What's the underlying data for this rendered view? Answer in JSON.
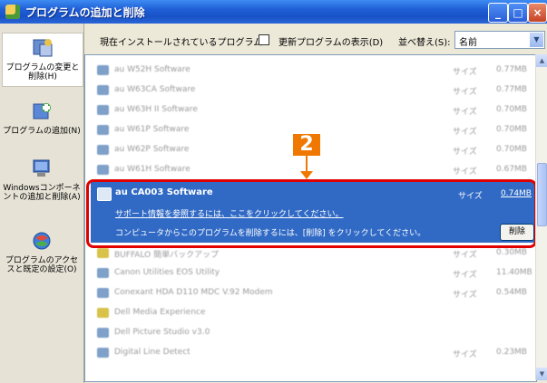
{
  "window": {
    "title": "プログラムの追加と削除",
    "buttons": {
      "minimize": "_",
      "maximize": "□",
      "close": "×"
    }
  },
  "sidebar": {
    "items": [
      {
        "label": "プログラムの変更と削除(H)",
        "icon": "change-remove-programs-icon"
      },
      {
        "label": "プログラムの追加(N)",
        "icon": "add-programs-icon"
      },
      {
        "label": "Windowsコンポーネントの追加と削除(A)",
        "icon": "windows-components-icon"
      },
      {
        "label": "プログラムのアクセスと既定の設定(O)",
        "icon": "program-access-defaults-icon"
      }
    ]
  },
  "toolbar": {
    "installed_label": "現在インストールされているプログラム:",
    "show_updates_label": "更新プログラムの表示(D)",
    "sort_label": "並べ替え(S):",
    "sort_value": "名前"
  },
  "list": {
    "rows_above": [
      {
        "name": "au W52H Software",
        "size_label": "サイズ",
        "size": "0.77MB"
      },
      {
        "name": "au W63CA Software",
        "size_label": "サイズ",
        "size": "0.77MB"
      },
      {
        "name": "au W63H II Software",
        "size_label": "サイズ",
        "size": "0.70MB"
      },
      {
        "name": "au W61P Software",
        "size_label": "サイズ",
        "size": "0.70MB"
      },
      {
        "name": "au W62P Software",
        "size_label": "サイズ",
        "size": "0.70MB"
      },
      {
        "name": "au W61H Software",
        "size_label": "サイズ",
        "size": "0.67MB"
      }
    ],
    "selected": {
      "name": "au CA003 Software",
      "size_label": "サイズ",
      "size": "0.74MB",
      "support_link": "サポート情報を参照するには、ここをクリックしてください。",
      "remove_text": "コンピュータからこのプログラムを削除するには、[削除] をクリックしてください。",
      "remove_button": "削除"
    },
    "rows_below": [
      {
        "name": "BUFFALO 簡単バックアップ",
        "size_label": "サイズ",
        "size": "0.30MB"
      },
      {
        "name": "Canon Utilities EOS Utility",
        "size_label": "サイズ",
        "size": "11.40MB"
      },
      {
        "name": "Conexant HDA D110 MDC V.92 Modem",
        "size_label": "サイズ",
        "size": "0.54MB"
      },
      {
        "name": "Dell Media Experience",
        "size_label": "",
        "size": ""
      },
      {
        "name": "Dell Picture Studio v3.0",
        "size_label": "",
        "size": ""
      },
      {
        "name": "Digital Line Detect",
        "size_label": "サイズ",
        "size": "0.23MB"
      }
    ]
  },
  "callout": {
    "number": "2"
  },
  "scrollbar": {
    "up": "▲",
    "down": "▼"
  }
}
